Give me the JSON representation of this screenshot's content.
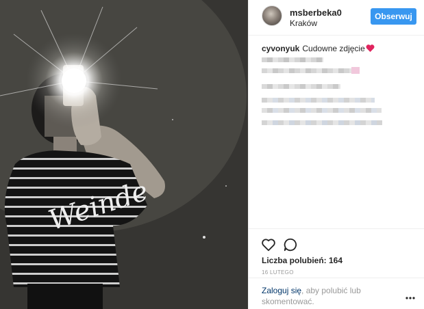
{
  "header": {
    "username": "msberbeka0",
    "location": "Kraków",
    "follow_label": "Obserwuj"
  },
  "comment": {
    "user": "cyvonyuk",
    "text": "Cudowne zdjęcie",
    "emoji": "heart-emoji"
  },
  "post": {
    "likes_text": "Liczba polubień: 164",
    "date": "16 LUTEGO",
    "login_link": "Zaloguj się",
    "login_rest": ", aby polubić lub skomentować."
  },
  "colors": {
    "accent": "#3897f0",
    "link": "#003569",
    "muted": "#999999",
    "heart": "#ed4956"
  },
  "icons": {
    "like": "heart-outline-icon",
    "comment": "comment-bubble-icon",
    "more": "more-options-icon"
  }
}
